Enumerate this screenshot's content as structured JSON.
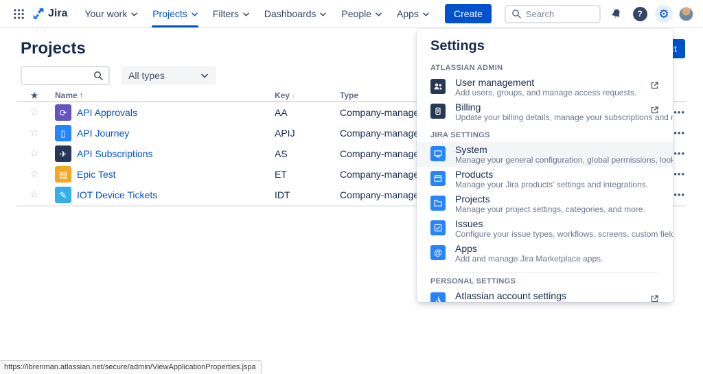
{
  "topnav": {
    "logo_text": "Jira",
    "items": [
      {
        "label": "Your work"
      },
      {
        "label": "Projects",
        "active": true
      },
      {
        "label": "Filters"
      },
      {
        "label": "Dashboards"
      },
      {
        "label": "People"
      },
      {
        "label": "Apps"
      }
    ],
    "create_label": "Create",
    "search_placeholder": "Search",
    "icons": [
      "app-switcher-icon",
      "jira-logo",
      "notification-bell-icon",
      "help-icon",
      "settings-gear-icon",
      "avatar"
    ]
  },
  "page": {
    "title": "Projects",
    "type_filter_value": "All types",
    "create_project_label": "Create project"
  },
  "table": {
    "columns": {
      "name": "Name",
      "key": "Key",
      "type": "Type"
    },
    "sort_arrow": "↑",
    "more_label": "•••",
    "rows": [
      {
        "name": "API Approvals",
        "key": "AA",
        "type": "Company-managed",
        "avatar_color": "#6554C0",
        "avatar_icon": "sync-icon",
        "avatar_char": "⟳"
      },
      {
        "name": "API Journey",
        "key": "APIJ",
        "type": "Company-managed",
        "avatar_color": "#2684FF",
        "avatar_icon": "phone-icon",
        "avatar_char": "▯"
      },
      {
        "name": "API Subscriptions",
        "key": "AS",
        "type": "Company-managed",
        "avatar_color": "#253858",
        "avatar_icon": "rocket-icon",
        "avatar_char": "✈"
      },
      {
        "name": "Epic Test",
        "key": "ET",
        "type": "Company-managed",
        "avatar_color": "#F5A623",
        "avatar_icon": "bed-icon",
        "avatar_char": "▤"
      },
      {
        "name": "IOT Device Tickets",
        "key": "IDT",
        "type": "Company-managed",
        "avatar_color": "#36B0E4",
        "avatar_icon": "notepad-icon",
        "avatar_char": "✎"
      }
    ]
  },
  "settings_panel": {
    "title": "Settings",
    "sections": [
      {
        "heading": "ATLASSIAN ADMIN",
        "items": [
          {
            "title": "User management",
            "desc": "Add users, groups, and manage access requests.",
            "icon": "users-icon",
            "icon_bg": "#253858",
            "external": true
          },
          {
            "title": "Billing",
            "desc": "Update your billing details, manage your subscriptions and more.",
            "icon": "billing-icon",
            "icon_bg": "#253858",
            "external": true
          }
        ]
      },
      {
        "heading": "JIRA SETTINGS",
        "items": [
          {
            "title": "System",
            "desc": "Manage your general configuration, global permissions, look and feel and more.",
            "icon": "system-icon",
            "icon_bg": "#2684FF",
            "highlight": true
          },
          {
            "title": "Products",
            "desc": "Manage your Jira products' settings and integrations.",
            "icon": "products-icon",
            "icon_bg": "#2684FF"
          },
          {
            "title": "Projects",
            "desc": "Manage your project settings, categories, and more.",
            "icon": "folder-icon",
            "icon_bg": "#2684FF"
          },
          {
            "title": "Issues",
            "desc": "Configure your issue types, workflows, screens, custom fields and more.",
            "icon": "issues-icon",
            "icon_bg": "#2684FF"
          },
          {
            "title": "Apps",
            "desc": "Add and manage Jira Marketplace apps.",
            "icon": "apps-icon",
            "icon_bg": "#2684FF"
          }
        ]
      },
      {
        "heading": "PERSONAL SETTINGS",
        "divided": true,
        "items": [
          {
            "title": "Atlassian account settings",
            "desc": "",
            "icon": "atlassian-icon",
            "icon_bg": "#2684FF",
            "external": true
          }
        ]
      }
    ]
  },
  "statusbar": {
    "url": "https://lbrenman.atlassian.net/secure/admin/ViewApplicationProperties.jspa"
  },
  "colors": {
    "accent": "#0052CC",
    "admin_icon_bg": "#253858",
    "jira_icon_bg": "#2684FF",
    "highlight_row": "#F4F5F7",
    "link": "#0052CC"
  }
}
